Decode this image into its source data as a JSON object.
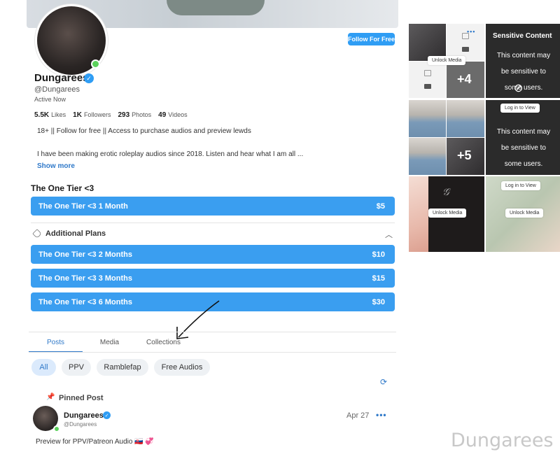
{
  "profile": {
    "follow_button": "Follow For Free",
    "name": "Dungarees",
    "handle": "@Dungarees",
    "status": "Active Now",
    "stats": [
      {
        "value": "5.5K",
        "label": "Likes"
      },
      {
        "value": "1K",
        "label": "Followers"
      },
      {
        "value": "293",
        "label": "Photos"
      },
      {
        "value": "49",
        "label": "Videos"
      }
    ],
    "bio_line1": "18+ || Follow for free || Access to purchase audios and preview lewds",
    "bio_line2": "I have been making erotic roleplay audios since 2018. Listen and hear what I am all ...",
    "show_more": "Show more"
  },
  "subscription": {
    "tier_title": "The One Tier <3",
    "main_plan": {
      "label": "The One Tier <3 1 Month",
      "price": "$5"
    },
    "additional_label": "Additional Plans",
    "plans": [
      {
        "label": "The One Tier <3 2 Months",
        "price": "$10"
      },
      {
        "label": "The One Tier <3 3 Months",
        "price": "$15"
      },
      {
        "label": "The One Tier <3 6 Months",
        "price": "$30"
      }
    ]
  },
  "tabs": [
    "Posts",
    "Media",
    "Collections"
  ],
  "filters": [
    "All",
    "PPV",
    "Ramblefap",
    "Free Audios"
  ],
  "post": {
    "pinned_label": "Pinned Post",
    "name": "Dungarees",
    "handle": "@Dungarees",
    "date": "Apr 27",
    "more": "•••",
    "text": "Preview for PPV/Patreon Audio 🇸🇰 💞"
  },
  "media": {
    "unlock": "Unlock Media",
    "plus4": "+4",
    "plus5": "+5",
    "sensitive_title": "Sensitive Content",
    "sensitive_lines": [
      "This content may",
      "be sensitive to",
      "some users."
    ],
    "login": "Log in to View"
  },
  "watermark": "Dungarees",
  "colors": {
    "accent": "#3a9ef0",
    "link": "#2f79c9",
    "online": "#5bd15b"
  }
}
